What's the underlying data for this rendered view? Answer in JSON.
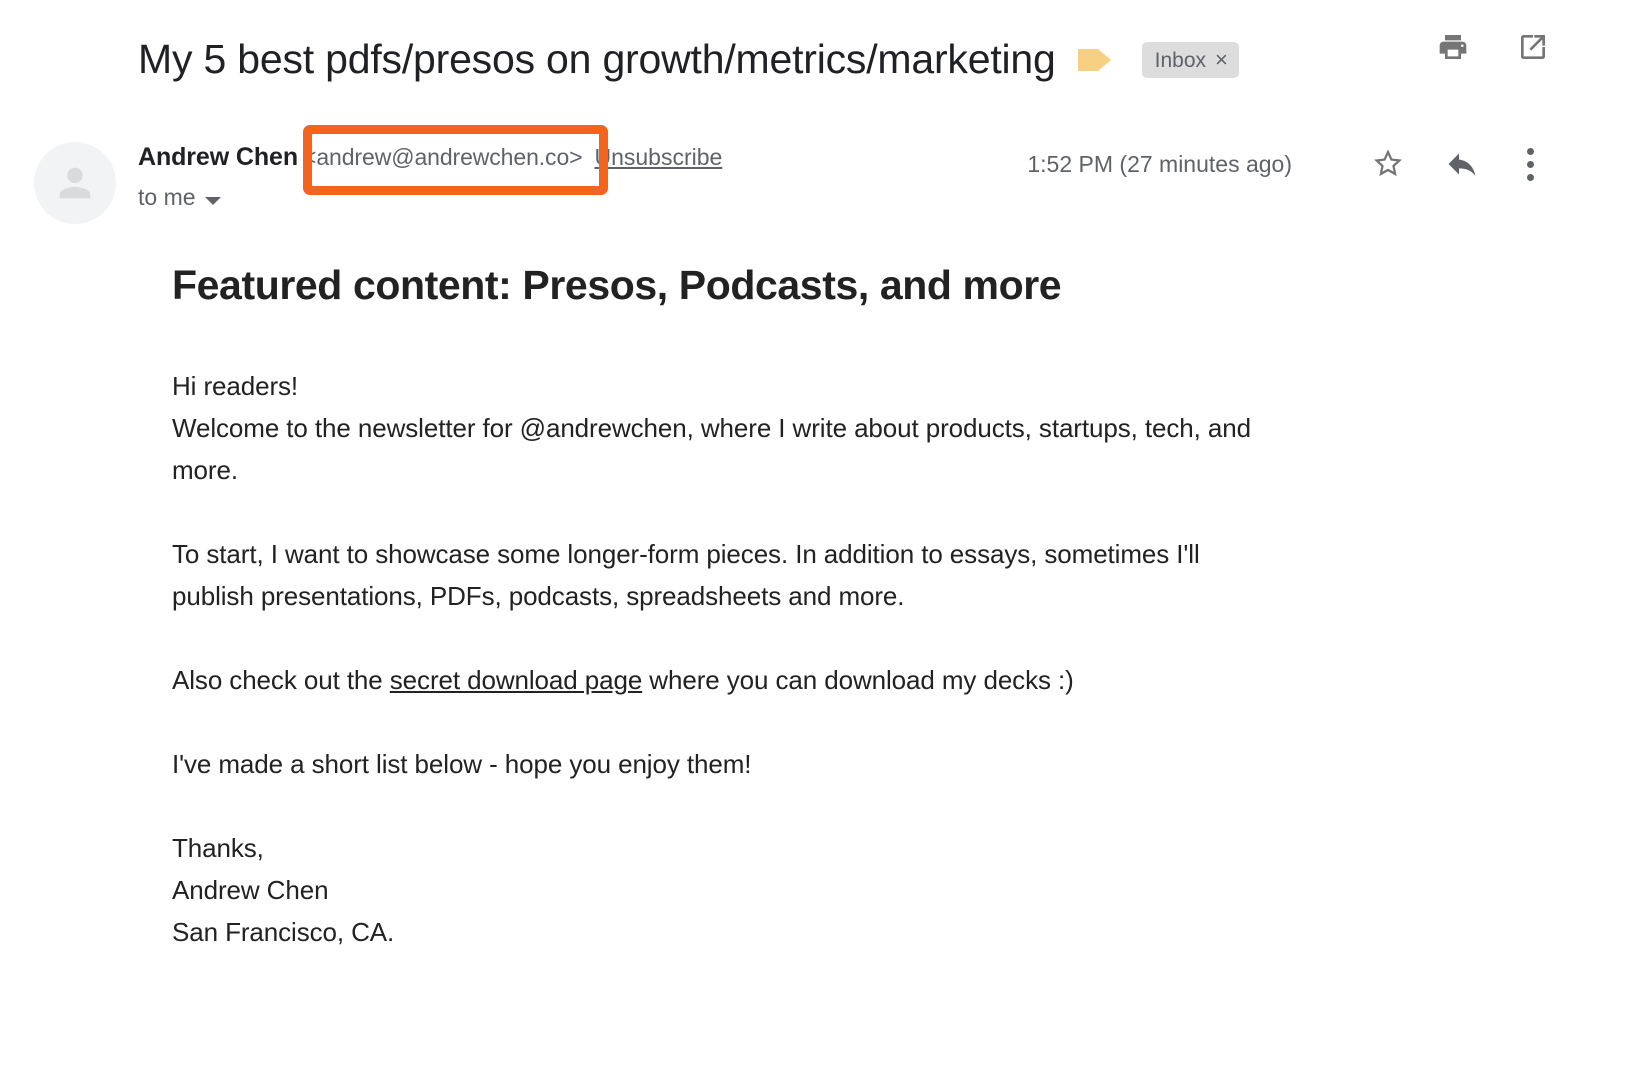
{
  "subject": {
    "text": "My 5 best pdfs/presos on growth/metrics/marketing",
    "important_marker_icon": "important-marker-icon",
    "label_chip": "Inbox",
    "label_chip_remove": "×"
  },
  "subject_actions": [
    {
      "icon": "print-icon",
      "label": "Print all"
    },
    {
      "icon": "open-in-new-window-icon",
      "label": "In new window"
    }
  ],
  "sender": {
    "avatar_icon": "default-avatar-icon",
    "name": "Andrew Chen",
    "email": "<andrew@andrewchen.co>",
    "unsubscribe_label": "Unsubscribe",
    "recipient": "to me",
    "recipient_caret_icon": "chevron-down-icon",
    "timestamp": "1:52 PM (27 minutes ago)",
    "star_icon": "star-icon",
    "reply_icon": "reply-arrow-icon",
    "more_icon": "kebab-menu-icon"
  },
  "annotation": {
    "color": "#f4641e",
    "target": "sender-email"
  },
  "message": {
    "heading": "Featured content: Presos, Podcasts, and more",
    "greeting": "Hi readers!",
    "intro": "Welcome to the newsletter for @andrewchen, where I write about products, startups, tech, and more.",
    "paragraph_2": "To start, I want to showcase some longer-form pieces. In addition to essays, sometimes I'll publish presentations, PDFs, podcasts, spreadsheets and more.",
    "paragraph_3_before_link": "Also check out the ",
    "paragraph_3_link": "secret download page",
    "paragraph_3_after_link": " where you can download my decks :)",
    "paragraph_4": "I've made a short list below - hope you enjoy them!",
    "signoff": "Thanks,",
    "signature_name": "Andrew Chen",
    "signature_location": "San Francisco, CA."
  },
  "colors": {
    "text": "#202124",
    "muted": "#5f6368",
    "body_text": "#222222",
    "chip_bg": "#ddddde",
    "marker_yellow": "#f7d083",
    "annotation_orange": "#f4641e"
  }
}
